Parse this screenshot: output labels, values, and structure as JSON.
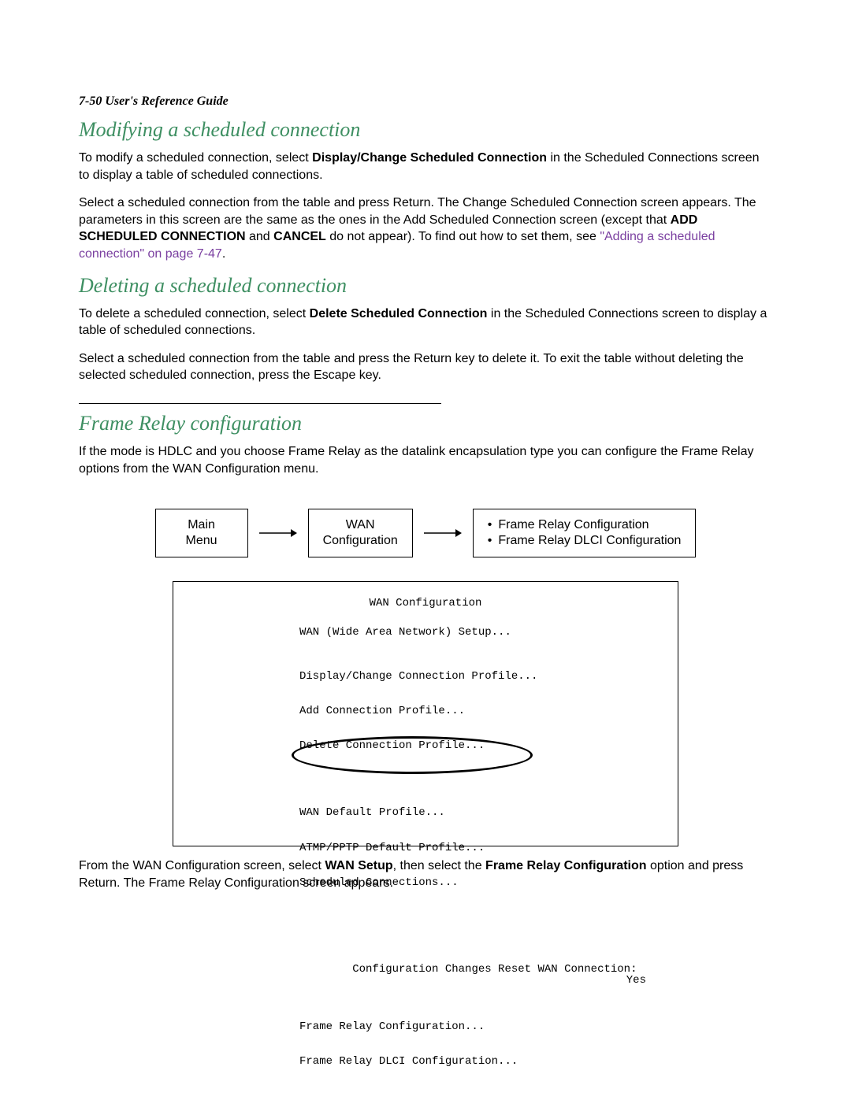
{
  "header": {
    "page_ref": "7-50  User's Reference Guide"
  },
  "sections": {
    "modify": {
      "title": "Modifying a scheduled connection",
      "p1_a": "To modify a scheduled connection, select ",
      "p1_bold": "Display/Change Scheduled Connection",
      "p1_b": " in the Scheduled Connections screen to display a table of scheduled connections.",
      "p2_a": "Select a scheduled connection from the table and press Return.  The Change Scheduled Connection screen appears. The parameters in this screen are the same as the ones in the Add Scheduled Connection screen (except that ",
      "p2_bold1": "ADD SCHEDULED CONNECTION",
      "p2_mid": " and ",
      "p2_bold2": "CANCEL",
      "p2_b": " do not appear). To find out how to set them, see ",
      "p2_link": "\"Adding a scheduled connection\" on page 7-47",
      "p2_end": "."
    },
    "delete": {
      "title": "Deleting a scheduled connection",
      "p1_a": "To delete a scheduled connection, select ",
      "p1_bold": "Delete Scheduled Connection",
      "p1_b": " in the Scheduled Connections screen to display a table of scheduled connections.",
      "p2": "Select a scheduled connection from the table and press the Return key to delete it. To exit the table without deleting the selected scheduled connection, press the Escape key."
    },
    "frame": {
      "title": "Frame Relay configuration",
      "p1": "If the mode is HDLC and you choose Frame Relay as the datalink encapsulation type you can configure the Frame Relay options from the WAN Configuration menu.",
      "flow": {
        "box1_l1": "Main",
        "box1_l2": "Menu",
        "box2_l1": "WAN",
        "box2_l2": "Configuration",
        "box3_b1": "Frame Relay Configuration",
        "box3_b2": "Frame Relay DLCI Configuration"
      },
      "terminal": {
        "title": "WAN Configuration",
        "l_setup": "WAN (Wide Area Network) Setup...",
        "l_disp": "Display/Change Connection Profile...",
        "l_add": "Add Connection Profile...",
        "l_del": "Delete Connection Profile...",
        "l_wdef": "WAN Default Profile...",
        "l_atmp": "ATMP/PPTP Default Profile...",
        "l_sched": "Scheduled Connections...",
        "l_reset": "Configuration Changes Reset WAN Connection:",
        "l_reset_val": "Yes",
        "l_fr": "Frame Relay Configuration...",
        "l_frd": "Frame Relay DLCI Configuration..."
      },
      "p_after_a": "From the WAN Configuration screen, select ",
      "p_after_b1": "WAN Setup",
      "p_after_mid": ", then select the ",
      "p_after_b2": "Frame Relay Configuration",
      "p_after_end": " option and press Return. The Frame Relay Configuration screen appears."
    }
  }
}
